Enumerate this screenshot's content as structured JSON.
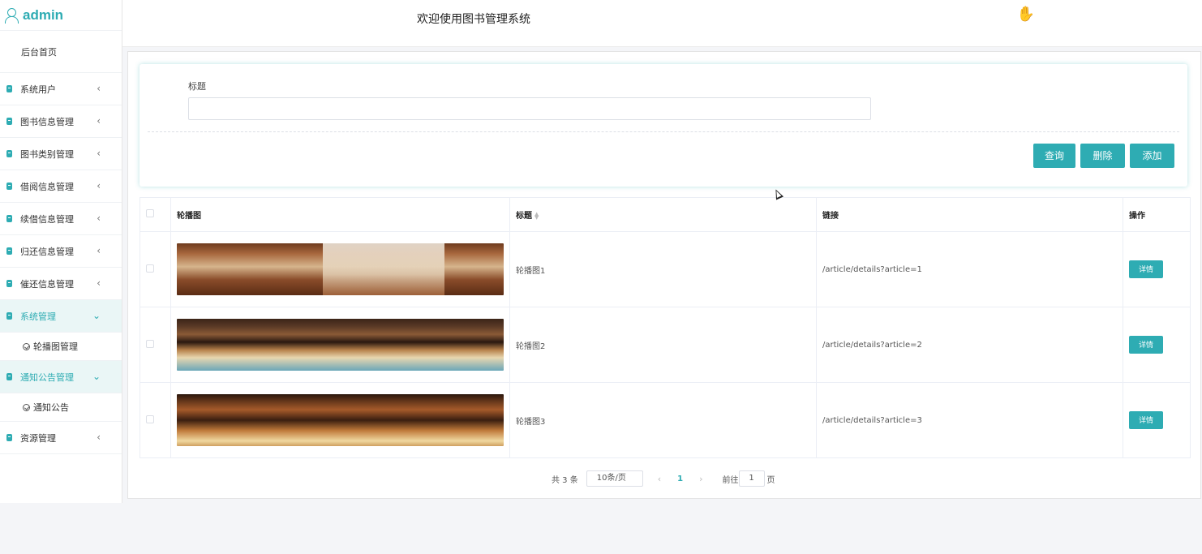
{
  "app": {
    "user": "admin",
    "header_title": "欢迎使用图书管理系统"
  },
  "sidebar": {
    "home": "后台首页",
    "items": [
      {
        "label": "系统用户"
      },
      {
        "label": "图书信息管理"
      },
      {
        "label": "图书类别管理"
      },
      {
        "label": "借阅信息管理"
      },
      {
        "label": "续借信息管理"
      },
      {
        "label": "归还信息管理"
      },
      {
        "label": "催还信息管理"
      },
      {
        "label": "系统管理"
      },
      {
        "label": "通知公告管理"
      },
      {
        "label": "资源管理"
      }
    ],
    "sub_carousel": "轮播图管理",
    "sub_notice": "通知公告",
    "arrow_collapsed": "‹",
    "arrow_expanded": "⌄"
  },
  "search": {
    "label": "标题",
    "value": "",
    "query_btn": "查询",
    "delete_btn": "删除",
    "add_btn": "添加"
  },
  "table": {
    "headers": {
      "image": "轮播图",
      "title": "标题",
      "link": "链接",
      "action": "操作"
    },
    "rows": [
      {
        "title": "轮播图1",
        "link": "/article/details?article=1",
        "action": "详情"
      },
      {
        "title": "轮播图2",
        "link": "/article/details?article=2",
        "action": "详情"
      },
      {
        "title": "轮播图3",
        "link": "/article/details?article=3",
        "action": "详情"
      }
    ]
  },
  "pagination": {
    "total": "共 3 条",
    "page_size": "10条/页",
    "prev": "‹",
    "current": "1",
    "next": "›",
    "goto_label": "前往",
    "goto_value": "1",
    "goto_unit": "页"
  },
  "colors": {
    "accent": "#2eacb3"
  }
}
